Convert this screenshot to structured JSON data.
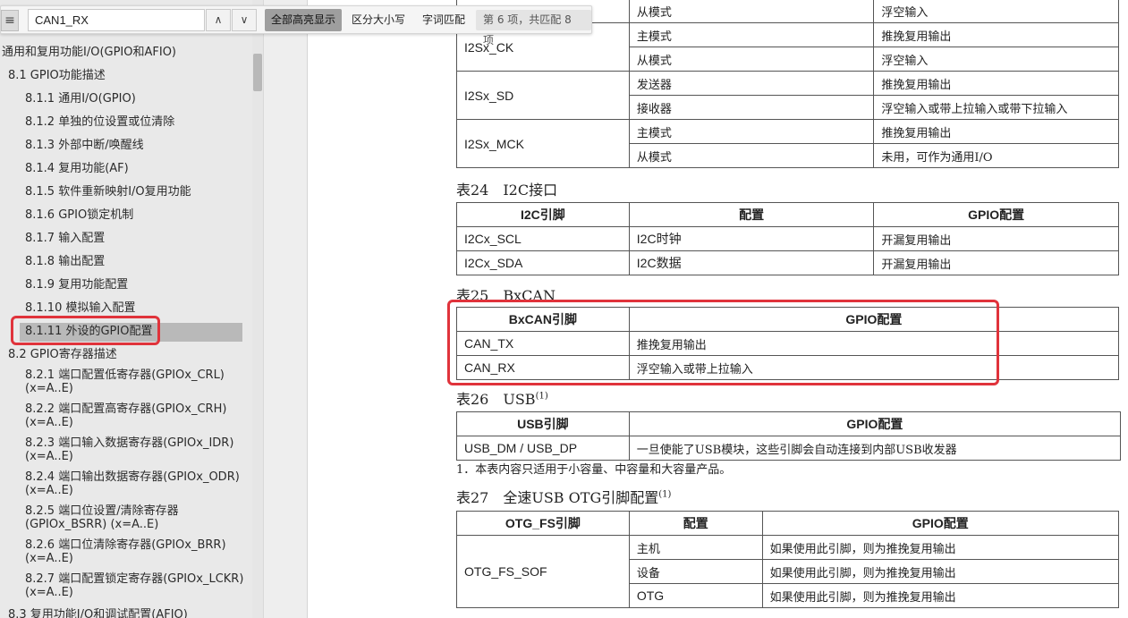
{
  "findbar": {
    "outline_icon": "≡",
    "query": "CAN1_RX",
    "prev_icon": "∧",
    "next_icon": "∨",
    "highlight_all": "全部高亮显示",
    "match_case": "区分大小写",
    "whole_words": "字词匹配",
    "match_count": "第 6 项，共匹配 8 项"
  },
  "outline": {
    "items": [
      {
        "label": "通用和复用功能I/O(GPIO和AFIO)"
      },
      {
        "label": "8.1 GPIO功能描述"
      },
      {
        "label": "8.1.1 通用I/O(GPIO)"
      },
      {
        "label": "8.1.2 单独的位设置或位清除"
      },
      {
        "label": "8.1.3 外部中断/唤醒线"
      },
      {
        "label": "8.1.4 复用功能(AF)"
      },
      {
        "label": "8.1.5 软件重新映射I/O复用功能"
      },
      {
        "label": "8.1.6 GPIO锁定机制"
      },
      {
        "label": "8.1.7 输入配置"
      },
      {
        "label": "8.1.8 输出配置"
      },
      {
        "label": "8.1.9 复用功能配置"
      },
      {
        "label": "8.1.10 模拟输入配置"
      },
      {
        "label": "8.1.11 外设的GPIO配置"
      },
      {
        "label": "8.2 GPIO寄存器描述"
      },
      {
        "label": "8.2.1 端口配置低寄存器(GPIOx_CRL) (x=A..E)"
      },
      {
        "label": "8.2.2 端口配置高寄存器(GPIOx_CRH) (x=A..E)"
      },
      {
        "label": "8.2.3 端口输入数据寄存器(GPIOx_IDR) (x=A..E)"
      },
      {
        "label": "8.2.4 端口输出数据寄存器(GPIOx_ODR) (x=A..E)"
      },
      {
        "label": "8.2.5 端口位设置/清除寄存器 (GPIOx_BSRR) (x=A..E)"
      },
      {
        "label": "8.2.6 端口位清除寄存器(GPIOx_BRR) (x=A..E)"
      },
      {
        "label": "8.2.7 端口配置锁定寄存器(GPIOx_LCKR) (x=A..E)"
      },
      {
        "label": "8.3 复用功能I/O和调试配置(AFIO)"
      }
    ]
  },
  "i2s_table": {
    "rows": [
      [
        "",
        "从模式",
        "浮空输入"
      ],
      [
        "I2Sx_CK",
        "主模式",
        "推挽复用输出"
      ],
      [
        "",
        "从模式",
        "浮空输入"
      ],
      [
        "I2Sx_SD",
        "发送器",
        "推挽复用输出"
      ],
      [
        "",
        "接收器",
        "浮空输入或带上拉输入或带下拉输入"
      ],
      [
        "I2Sx_MCK",
        "主模式",
        "推挽复用输出"
      ],
      [
        "",
        "从模式",
        "未用，可作为通用I/O"
      ]
    ]
  },
  "table24": {
    "caption": "表24　I2C接口",
    "headers": [
      "I2C引脚",
      "配置",
      "GPIO配置"
    ],
    "rows": [
      [
        "I2Cx_SCL",
        "I2C时钟",
        "开漏复用输出"
      ],
      [
        "I2Cx_SDA",
        "I2C数据",
        "开漏复用输出"
      ]
    ]
  },
  "table25": {
    "caption": "表25　BxCAN",
    "headers": [
      "BxCAN引脚",
      "GPIO配置"
    ],
    "rows": [
      [
        "CAN_TX",
        "推挽复用输出"
      ],
      [
        "CAN_RX",
        "浮空输入或带上拉输入"
      ]
    ]
  },
  "table26": {
    "caption": "表26　USB",
    "note_mark": "(1)",
    "headers": [
      "USB引脚",
      "GPIO配置"
    ],
    "rows": [
      [
        "USB_DM / USB_DP",
        "一旦使能了USB模块，这些引脚会自动连接到内部USB收发器"
      ]
    ],
    "footnote": "1．本表内容只适用于小容量、中容量和大容量产品。"
  },
  "table27": {
    "caption": "表27　全速USB OTG引脚配置",
    "note_mark": "(1)",
    "headers": [
      "OTG_FS引脚",
      "配置",
      "GPIO配置"
    ],
    "pin": "OTG_FS_SOF",
    "rows": [
      [
        "主机",
        "如果使用此引脚，则为推挽复用输出"
      ],
      [
        "设备",
        "如果使用此引脚，则为推挽复用输出"
      ],
      [
        "OTG",
        "如果使用此引脚，则为推挽复用输出"
      ]
    ]
  },
  "colors": {
    "highlight_box": "#e0333b",
    "sidebar_bg": "#e9e9e9",
    "selected_item_bg": "#b9b9b9"
  }
}
